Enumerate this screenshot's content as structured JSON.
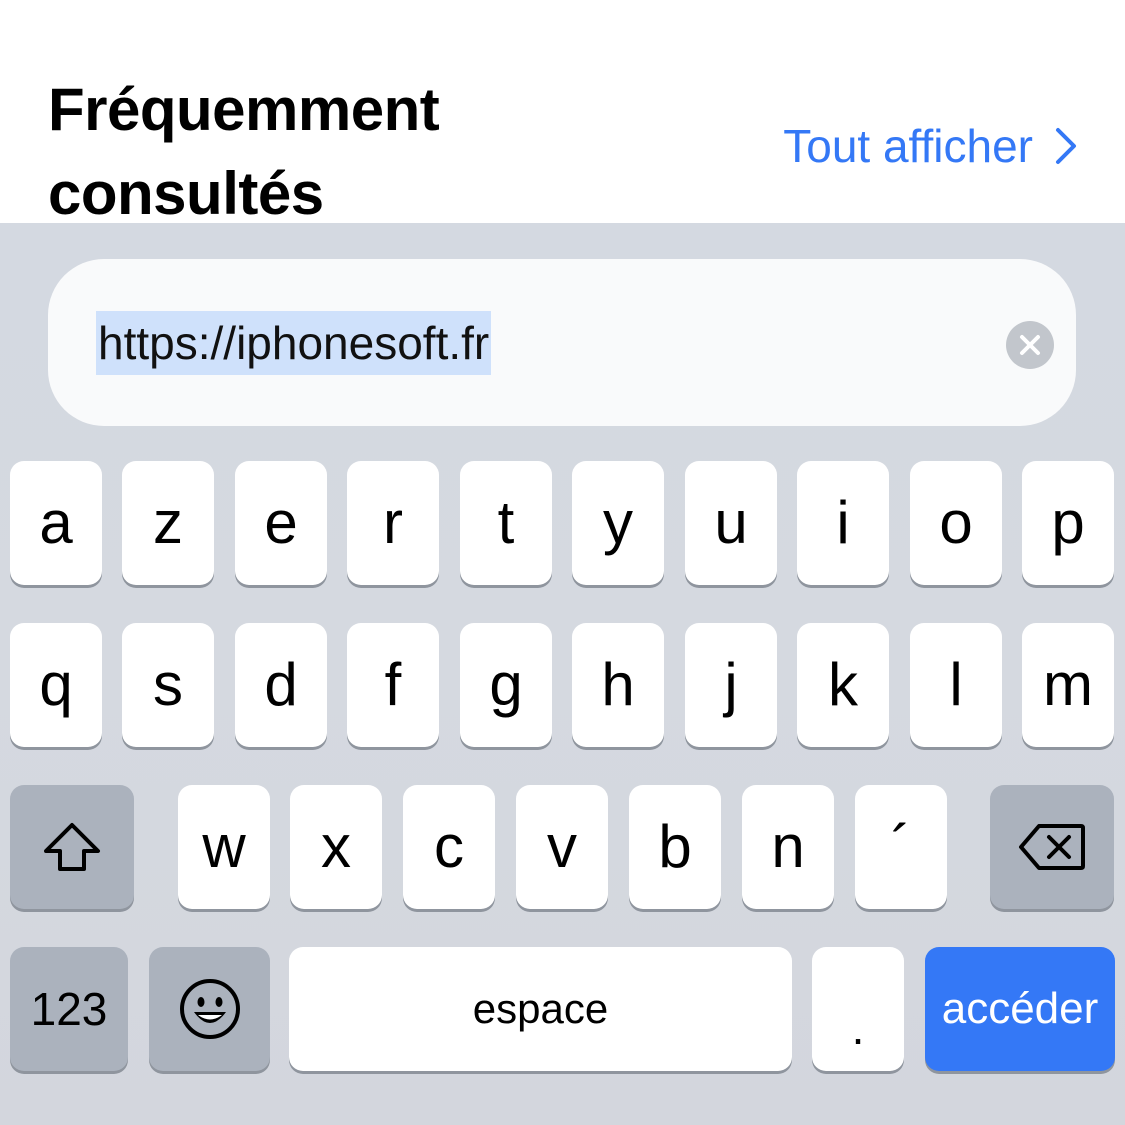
{
  "header": {
    "section_title_line1": "Fréquemment",
    "section_title_line2": "consultés",
    "show_all_label": "Tout afficher"
  },
  "url_bar": {
    "value": "https://iphonesoft.fr"
  },
  "keyboard": {
    "row1": [
      "a",
      "z",
      "e",
      "r",
      "t",
      "y",
      "u",
      "i",
      "o",
      "p"
    ],
    "row2": [
      "q",
      "s",
      "d",
      "f",
      "g",
      "h",
      "j",
      "k",
      "l",
      "m"
    ],
    "row3": [
      "w",
      "x",
      "c",
      "v",
      "b",
      "n",
      "´"
    ],
    "numbers_label": "123",
    "space_label": "espace",
    "period_label": ".",
    "go_label": "accéder"
  },
  "colors": {
    "accent": "#3478f6",
    "selection": "#cfe1fb",
    "keyboard_bg": "#d4d9e1",
    "dark_key": "#abb2bd"
  }
}
